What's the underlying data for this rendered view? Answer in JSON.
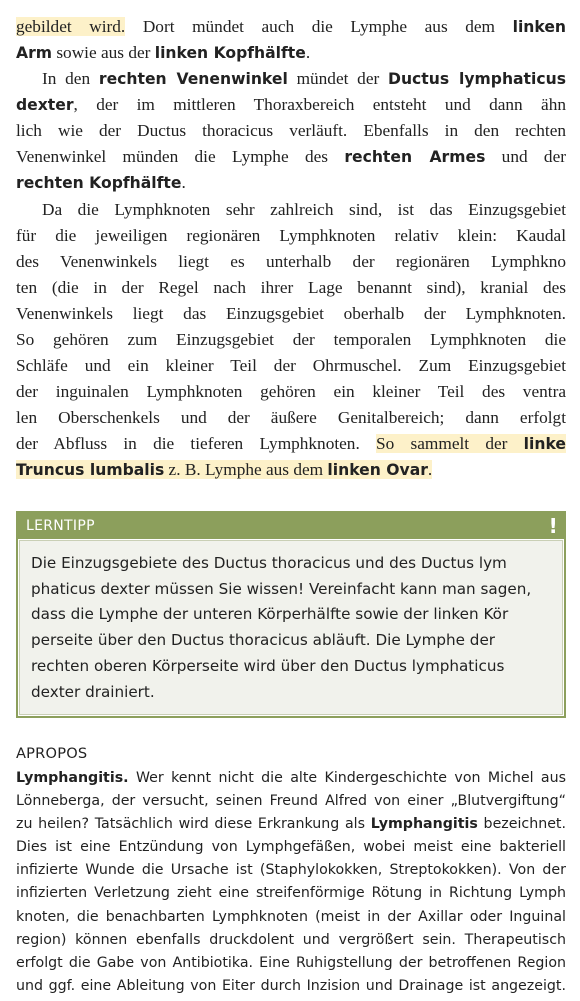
{
  "main": {
    "p1": {
      "l1": [
        "gebildet wird.",
        " Dort mündet auch die Lymphe aus dem ",
        "linken"
      ],
      "l2": [
        "Arm",
        " sowie aus der ",
        "linken Kopfhälfte",
        "."
      ]
    },
    "p2": {
      "l1": [
        "In den ",
        "rechten Venenwinkel",
        " mündet der ",
        "Ductus lymphaticus"
      ],
      "l2": [
        "dexter",
        ", der im mittleren Thoraxbereich entsteht und dann ähn"
      ],
      "l3": "lich wie der Ductus thoracicus verläuft. Ebenfalls in den rechten",
      "l4": [
        "Venenwinkel münden die Lymphe des ",
        "rechten Armes",
        " und der"
      ],
      "l5": [
        "rechten Kopfhälfte",
        "."
      ]
    },
    "p3": {
      "lines": [
        "Da die Lymphknoten sehr zahlreich sind, ist das Einzugsgebiet",
        "für die jeweiligen regionären Lymphknoten relativ klein: Kaudal",
        "des Venenwinkels liegt es unterhalb der regionären Lymphkno",
        "ten (die in der Regel nach ihrer Lage benannt sind), kranial des",
        "Venenwinkels liegt das Einzugsgebiet oberhalb der Lymphknoten.",
        "So gehören zum Einzugsgebiet der temporalen Lymphknoten die",
        "Schläfe und ein kleiner Teil der Ohrmuschel. Zum Einzugsgebiet",
        "der inguinalen Lymphknoten gehören ein kleiner Teil des ventra",
        "len Oberschenkels und der äußere Genitalbereich; dann erfolgt"
      ],
      "l10": [
        "der Abfluss in die tieferen Lymphknoten. ",
        "So sammelt der ",
        "linke"
      ],
      "l11": [
        "Truncus lumbalis",
        " z. B. Lymphe aus dem ",
        "linken Ovar",
        "."
      ]
    }
  },
  "tip": {
    "title": "LERNTIPP",
    "icon": "!",
    "lines": [
      "Die Einzugsgebiete des Ductus thoracicus und des Ductus lym",
      "phaticus dexter müssen Sie wissen! Vereinfacht kann man sagen,",
      "dass die Lymphe der unteren Körperhälfte sowie der linken Kör",
      "perseite über den Ductus thoracicus abläuft. Die Lymphe der",
      "rechten oberen Körperseite wird über den Ductus lymphaticus",
      "dexter drainiert."
    ]
  },
  "apropos": {
    "heading": "APROPOS",
    "l1": [
      "Lymphangitis.",
      " Wer kennt nicht die alte Kindergeschichte von Michel aus"
    ],
    "l2": "Lönneberga, der versucht, seinen Freund Alfred von einer „Blutvergiftung“",
    "l3": [
      "zu heilen? Tatsächlich wird diese Erkrankung als ",
      "Lymphangitis",
      " bezeichnet."
    ],
    "lines": [
      "Dies ist eine Entzündung von Lymphgefäßen, wobei meist eine bakteriell",
      "infizierte Wunde die Ursache ist (Staphylokokken, Streptokokken). Von der",
      "infizierten Verletzung zieht eine streifenförmige Rötung in Richtung Lymph",
      "knoten, die benachbarten Lymphknoten (meist in der Axillar  oder Inguinal",
      "region) können ebenfalls druckdolent und vergrößert sein. Therapeutisch",
      "erfolgt die Gabe von Antibiotika. Eine Ruhigstellung der betroffenen Region",
      "und ggf. eine Ableitung von Eiter durch Inzision und Drainage ist angezeigt."
    ]
  },
  "colors": {
    "tip_green": "#8c9f5c",
    "highlight": "#fdf1c9"
  }
}
